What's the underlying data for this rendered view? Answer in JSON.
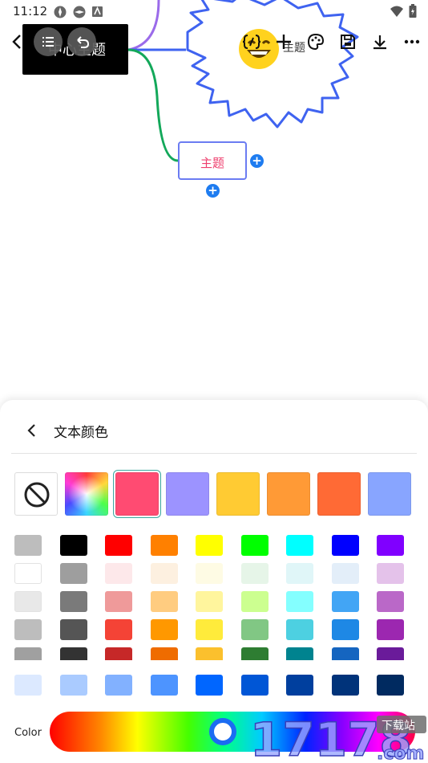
{
  "status_bar": {
    "time": "11:12"
  },
  "canvas": {
    "central_topic": "中心主题",
    "topic_node": "主题",
    "blob_label": "主题",
    "colors": {
      "branch_purple": "#9b6bea",
      "branch_green": "#13a85a",
      "blob_blue": "#3f63f0",
      "topic_border": "#6b7cf2",
      "topic_text": "#ee3f6e"
    }
  },
  "toolbar": {
    "icons": [
      "back-arrow-icon",
      "outline-list-icon",
      "undo-icon",
      "format-brackets-icon",
      "add-icon",
      "palette-icon",
      "save-icon",
      "download-icon",
      "more-icon"
    ]
  },
  "color_sheet": {
    "title": "文本颜色",
    "presets": [
      {
        "name": "none",
        "color": ""
      },
      {
        "name": "custom-gradient",
        "color": ""
      },
      {
        "name": "pink",
        "color": "#ff4b72",
        "selected": true
      },
      {
        "name": "lavender",
        "color": "#9c93ff"
      },
      {
        "name": "amber",
        "color": "#ffcb33"
      },
      {
        "name": "orange",
        "color": "#ff9a36"
      },
      {
        "name": "deep-orange",
        "color": "#ff6a35"
      },
      {
        "name": "periwinkle",
        "color": "#88a5ff"
      }
    ],
    "grid": [
      [
        "#bdbdbd",
        "#000000",
        "#ff0000",
        "#ff8000",
        "#ffff00",
        "#00ff00",
        "#00ffff",
        "#0000ff",
        "#8000ff"
      ],
      [
        "#ffffff",
        "#9e9e9e",
        "#fde8ea",
        "#fdf0e0",
        "#fefbe4",
        "#e6f5e8",
        "#e0f6f8",
        "#e3eef9",
        "#e4c2ea"
      ],
      [
        "#e8e8e8",
        "#7a7a7a",
        "#ef9a9a",
        "#ffcc80",
        "#fff59d",
        "#ccff90",
        "#84ffff",
        "#42a5f5",
        "#ba68c8"
      ],
      [
        "#bdbdbd",
        "#555555",
        "#f44336",
        "#ff9800",
        "#ffeb3b",
        "#81c784",
        "#4dd0e1",
        "#1e88e5",
        "#9c27b0"
      ],
      [
        "#a0a0a0",
        "#333333",
        "#c62828",
        "#ef6c00",
        "#fbc02d",
        "#2e7d32",
        "#00838f",
        "#1565c0",
        "#6a1b9a"
      ]
    ],
    "blue_row": [
      "#dce9ff",
      "#aacbff",
      "#82b1ff",
      "#4d94ff",
      "#0066ff",
      "#0056d6",
      "#003f9e",
      "#00337a",
      "#002a60"
    ],
    "color_label": "Color",
    "hue_position": 0.5,
    "watermark": {
      "number": "17178",
      "tag": "下载站",
      "domain": ".com"
    }
  }
}
